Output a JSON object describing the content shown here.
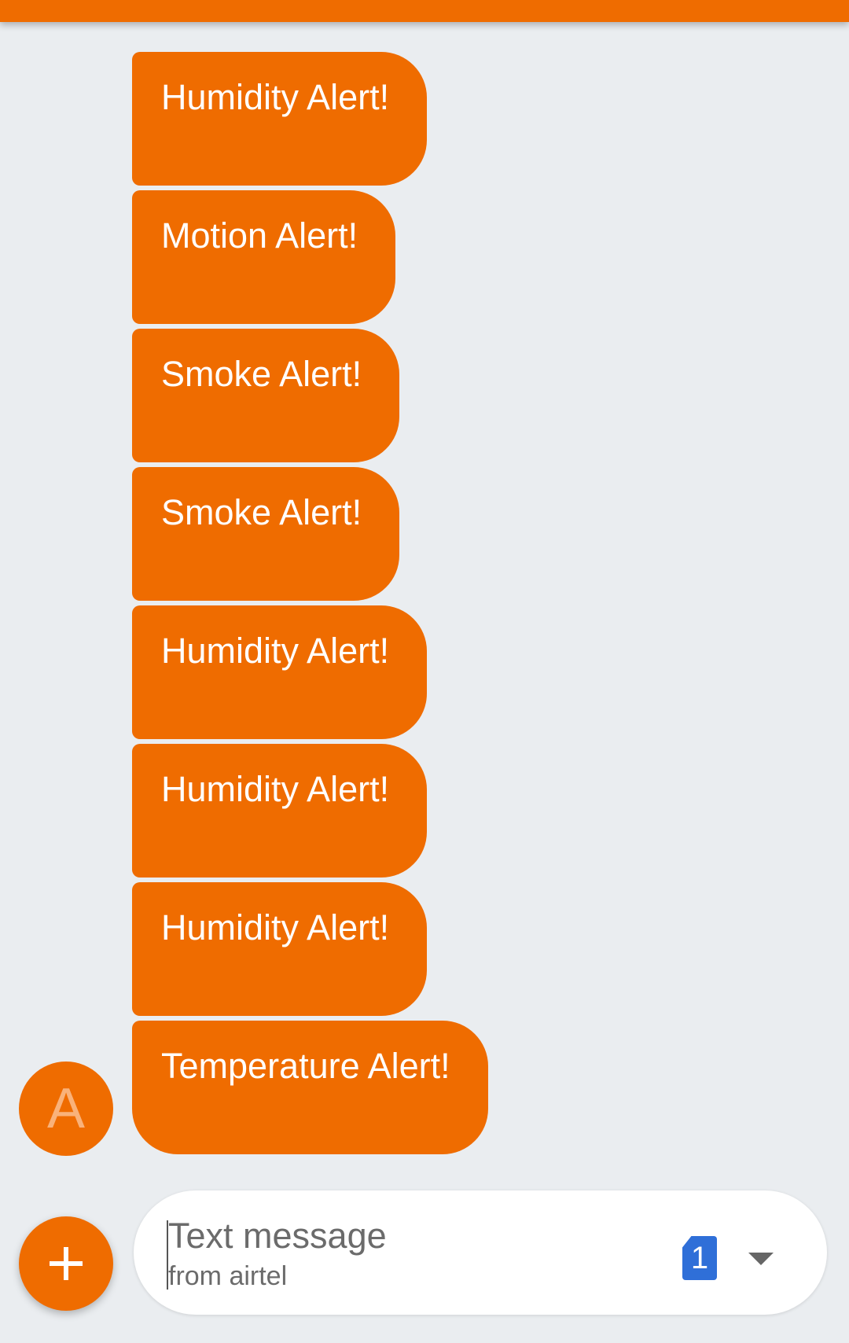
{
  "colors": {
    "accent": "#ef6c00",
    "background": "#eaedf0",
    "sim_badge": "#2f6fd8"
  },
  "conversation": {
    "messages": [
      {
        "text": "Humidity Alert!"
      },
      {
        "text": "Motion Alert!"
      },
      {
        "text": "Smoke Alert!"
      },
      {
        "text": "Smoke Alert!"
      },
      {
        "text": "Humidity Alert!"
      },
      {
        "text": "Humidity Alert!"
      },
      {
        "text": "Humidity Alert!"
      },
      {
        "text": "Temperature Alert!"
      }
    ],
    "sender_avatar_letter": "A"
  },
  "composer": {
    "placeholder": "Text message",
    "sublabel": "from airtel",
    "sim_number": "1",
    "attach_icon": "plus-icon",
    "dropdown_icon": "chevron-down-icon"
  }
}
